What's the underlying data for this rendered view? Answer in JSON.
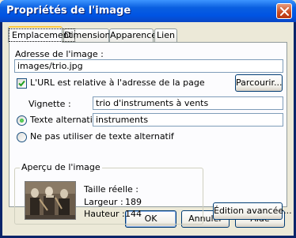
{
  "window": {
    "title": "Propriétés de l'image"
  },
  "tabs": [
    {
      "label": "Emplacement",
      "active": true
    },
    {
      "label": "Dimensions",
      "active": false
    },
    {
      "label": "Apparence",
      "active": false
    },
    {
      "label": "Lien",
      "active": false
    }
  ],
  "location": {
    "address_label": "Adresse de l'image :",
    "address_value": "images/trio.jpg",
    "relative_url_label": "L'URL est relative à l'adresse de la page",
    "relative_url_checked": true,
    "browse_button": "Parcourir...",
    "tooltip_label": "Vignette :",
    "tooltip_value": "trio d'instruments à vents",
    "alt_text_label": "Texte alternatif :",
    "alt_text_value": "instruments",
    "alt_text_selected": true,
    "no_alt_label": "Ne pas utiliser de texte alternatif"
  },
  "preview": {
    "group_title": "Aperçu de l'image",
    "real_size_label": "Taille réelle :",
    "width_label": "Largeur :",
    "width_value": "189",
    "height_label": "Hauteur :",
    "height_value": "144"
  },
  "buttons": {
    "advanced_edit": "Édition avancée...",
    "ok": "OK",
    "cancel": "Annuler",
    "help": "Aide"
  },
  "colors": {
    "title_bar": "#0054e3",
    "dialog_bg": "#ece9d8",
    "panel_bg": "#fcfcfe",
    "close_button": "#c94a20",
    "active_tab_highlight": "#ffc83c"
  }
}
